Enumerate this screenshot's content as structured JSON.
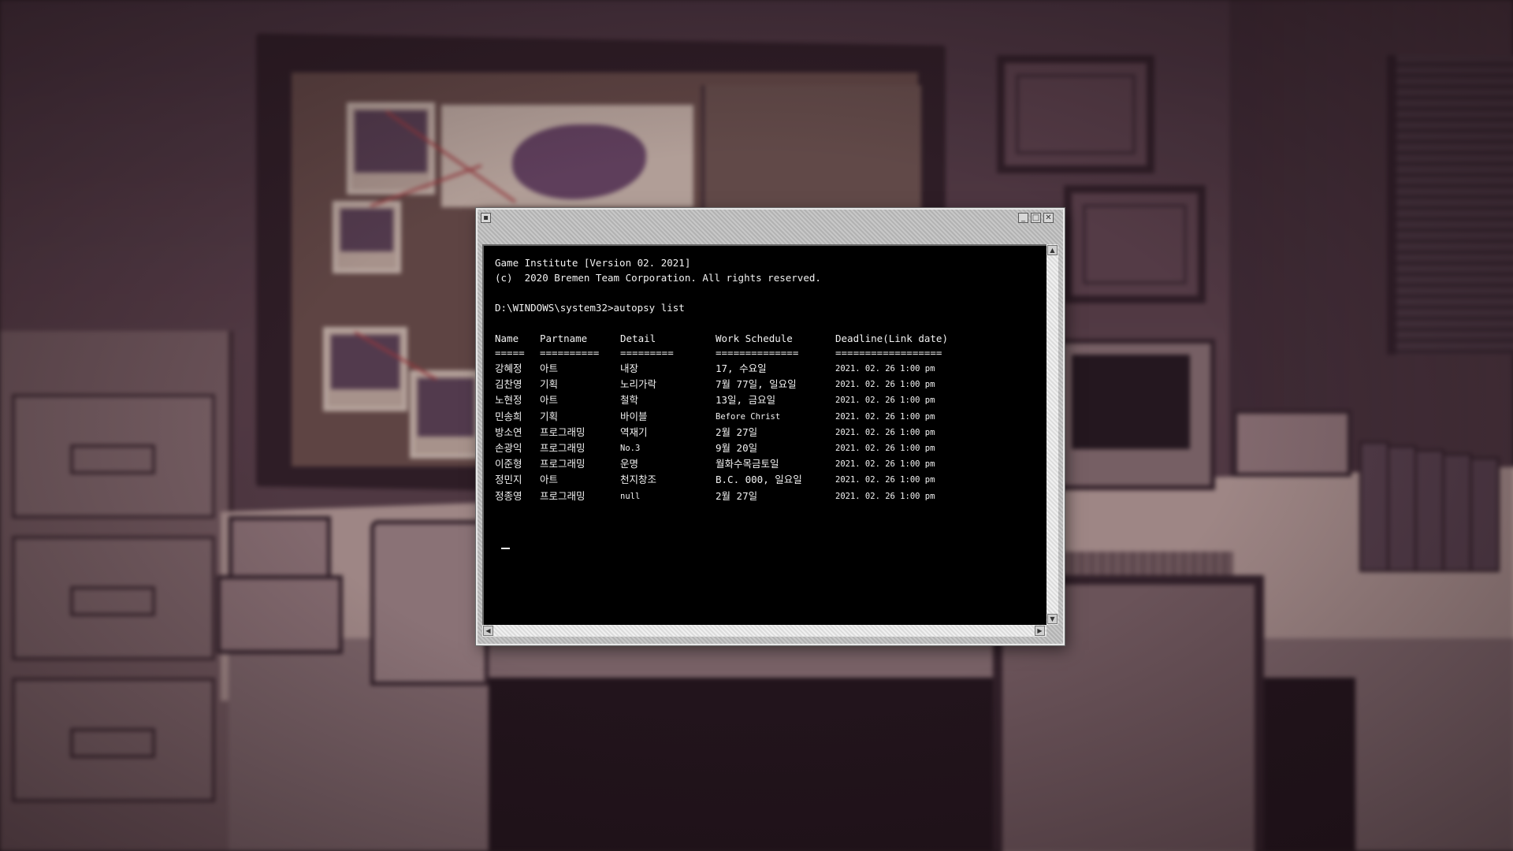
{
  "terminal": {
    "header_line1": "Game Institute [Version 02. 2021]",
    "header_line2": "(c)  2020 Bremen Team Corporation. All rights reserved.",
    "prompt_line": "D:\\WINDOWS\\system32>autopsy list",
    "columns": [
      "Name",
      "Partname",
      "Detail",
      "Work Schedule",
      "Deadline(Link date)"
    ],
    "separators": [
      "=====",
      "==========",
      "=========",
      "==============",
      "=================="
    ],
    "rows": [
      {
        "name": "강혜정",
        "part": "아트",
        "detail": "내장",
        "schedule": "17, 수요일",
        "deadline": "2021. 02. 26 1:00 pm"
      },
      {
        "name": "김찬영",
        "part": "기획",
        "detail": "노리가락",
        "schedule": "7월 77일, 일요일",
        "deadline": "2021. 02. 26 1:00 pm"
      },
      {
        "name": "노현정",
        "part": "아트",
        "detail": "철학",
        "schedule": "13일, 금요일",
        "deadline": "2021. 02. 26 1:00 pm"
      },
      {
        "name": "민송희",
        "part": "기획",
        "detail": "바이블",
        "schedule": "Before Christ",
        "deadline": "2021. 02. 26 1:00 pm"
      },
      {
        "name": "방소연",
        "part": "프로그래밍",
        "detail": "역재기",
        "schedule": "2월 27일",
        "deadline": "2021. 02. 26 1:00 pm"
      },
      {
        "name": "손광익",
        "part": "프로그래밍",
        "detail": "No.3",
        "schedule": "9월 20일",
        "deadline": "2021. 02. 26 1:00 pm"
      },
      {
        "name": "이준형",
        "part": "프로그래밍",
        "detail": "운명",
        "schedule": "월화수목금토일",
        "deadline": "2021. 02. 26 1:00 pm"
      },
      {
        "name": "정민지",
        "part": "아트",
        "detail": "천지창조",
        "schedule": "B.C. 000, 일요일",
        "deadline": "2021. 02. 26 1:00 pm"
      },
      {
        "name": "정종영",
        "part": "프로그래밍",
        "detail": "null",
        "schedule": "2월 27일",
        "deadline": "2021. 02. 26 1:00 pm"
      }
    ]
  },
  "window_controls": [
    "minimize-icon",
    "maximize-icon",
    "close-icon"
  ],
  "colors": {
    "terminal_bg": "#000000",
    "terminal_text": "#f2f2f2",
    "window_chrome": "#bdbdbd",
    "background_tint": "#4a3740"
  }
}
